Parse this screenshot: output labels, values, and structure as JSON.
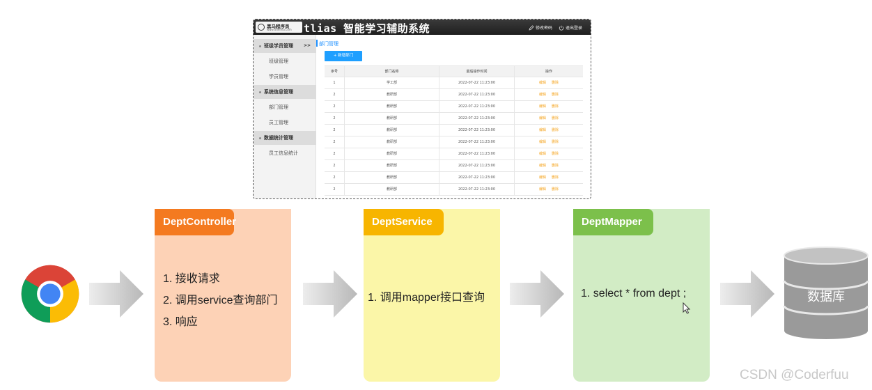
{
  "ui_screenshot": {
    "logo_text": "黑马程序员",
    "logo_sub": "www.itheima.com",
    "app_title": "tlias 智能学习辅助系统",
    "header_buttons": [
      "修改密码",
      "退出登录"
    ],
    "sidebar": {
      "groups": [
        {
          "label": "班级学员管理",
          "expand": ">>",
          "items": [
            "班级管理",
            "学员管理"
          ]
        },
        {
          "label": "系统信息管理",
          "items": [
            "部门管理",
            "员工管理"
          ]
        },
        {
          "label": "数据统计管理",
          "items": [
            "员工信息统计"
          ]
        }
      ]
    },
    "breadcrumb": "部门管理",
    "add_button": "+ 新增部门",
    "table": {
      "headers": [
        "序号",
        "部门名称",
        "最后操作时间",
        "操作"
      ],
      "rows": [
        [
          "1",
          "学工部",
          "2022-07-22 11:23:00"
        ],
        [
          "2",
          "教研部",
          "2022-07-22 11:23:00"
        ],
        [
          "2",
          "教研部",
          "2022-07-22 11:23:00"
        ],
        [
          "2",
          "教研部",
          "2022-07-22 11:23:00"
        ],
        [
          "2",
          "教研部",
          "2022-07-22 11:23:00"
        ],
        [
          "2",
          "教研部",
          "2022-07-22 11:23:00"
        ],
        [
          "2",
          "教研部",
          "2022-07-22 11:23:00"
        ],
        [
          "2",
          "教研部",
          "2022-07-22 11:23:00"
        ],
        [
          "2",
          "教研部",
          "2022-07-22 11:23:00"
        ],
        [
          "2",
          "教研部",
          "2022-07-22 11:23:00"
        ]
      ],
      "actions": [
        "编辑",
        "删除"
      ]
    }
  },
  "layers": {
    "controller": {
      "title": "DeptController",
      "steps": [
        "1.  接收请求",
        "2.  调用service查询部门",
        "3.  响应"
      ],
      "color": "#f47a20"
    },
    "service": {
      "title": "DeptService",
      "steps": [
        "1.  调用mapper接口查询"
      ],
      "color": "#f7b500"
    },
    "mapper": {
      "title": "DeptMapper",
      "steps": [
        "1.  select * from dept ;"
      ],
      "color": "#7cc04b"
    }
  },
  "database_label": "数据库",
  "icons": [
    "chrome-browser-icon",
    "arrow-right-icon",
    "database-icon",
    "pencil-icon",
    "power-icon",
    "mouse-cursor-icon"
  ],
  "watermark": "CSDN @Coderfuu"
}
